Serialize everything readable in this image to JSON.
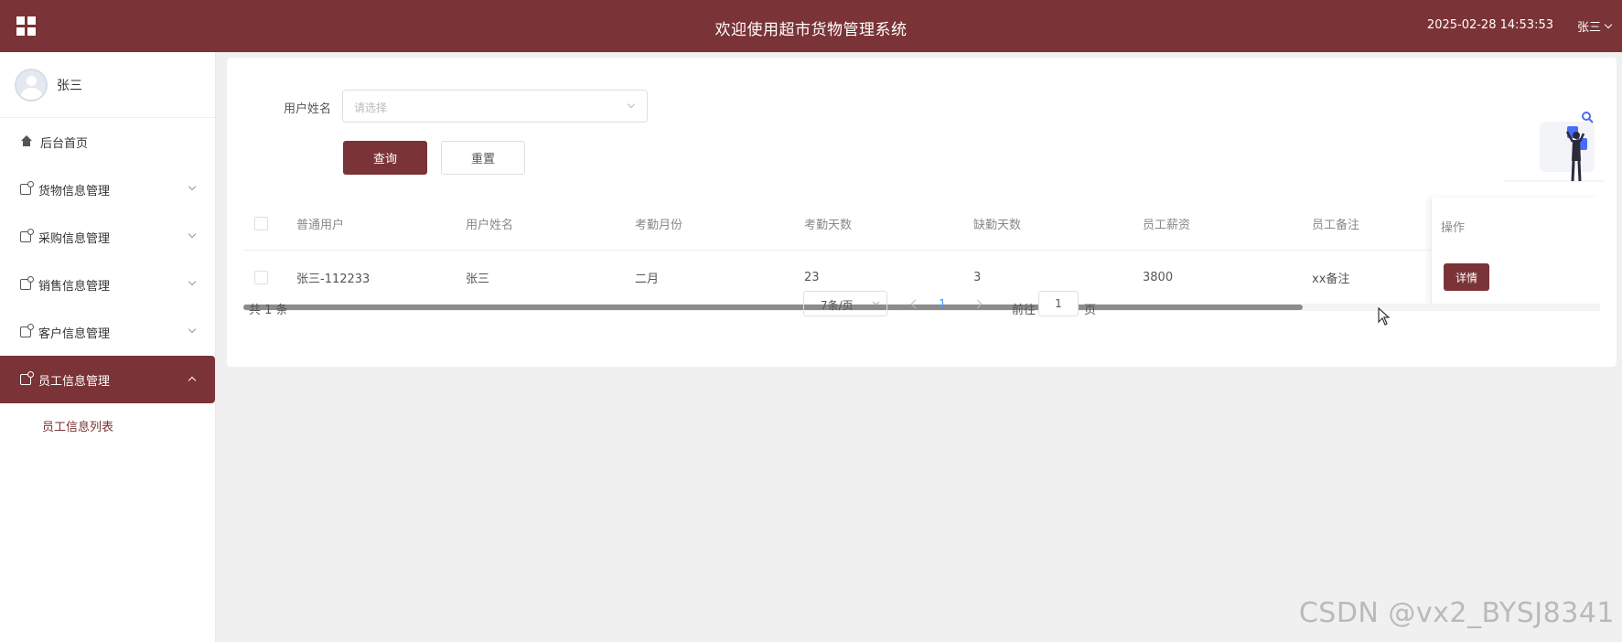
{
  "header": {
    "title": "欢迎使用超市货物管理系统",
    "datetime": "2025-02-28 14:53:53",
    "user": "张三"
  },
  "sidebar": {
    "profile_name": "张三",
    "items": [
      {
        "label": "后台首页",
        "icon": "home-icon"
      },
      {
        "label": "货物信息管理",
        "icon": "doc-icon"
      },
      {
        "label": "采购信息管理",
        "icon": "doc-icon"
      },
      {
        "label": "销售信息管理",
        "icon": "doc-icon"
      },
      {
        "label": "客户信息管理",
        "icon": "doc-icon"
      },
      {
        "label": "员工信息管理",
        "icon": "doc-icon",
        "active": true
      }
    ],
    "submenu": [
      {
        "label": "员工信息列表",
        "active": true
      }
    ]
  },
  "search": {
    "label": "用户姓名",
    "placeholder": "请选择",
    "query_label": "查询",
    "reset_label": "重置"
  },
  "table": {
    "columns": [
      "普通用户",
      "用户姓名",
      "考勤月份",
      "考勤天数",
      "缺勤天数",
      "员工薪资",
      "员工备注",
      "操作"
    ],
    "rows": [
      {
        "cells": [
          "张三-112233",
          "张三",
          "二月",
          "23",
          "3",
          "3800",
          "xx备注"
        ],
        "action": "详情"
      }
    ]
  },
  "pagination": {
    "total": "共 1 条",
    "page_size": "7条/页",
    "current_page": "1",
    "goto_label": "前往",
    "goto_value": "1",
    "goto_suffix": "页"
  },
  "watermark": "CSDN @vx2_BYSJ8341",
  "colors": {
    "brand": "#7a3336",
    "page_link": "#409eff"
  }
}
